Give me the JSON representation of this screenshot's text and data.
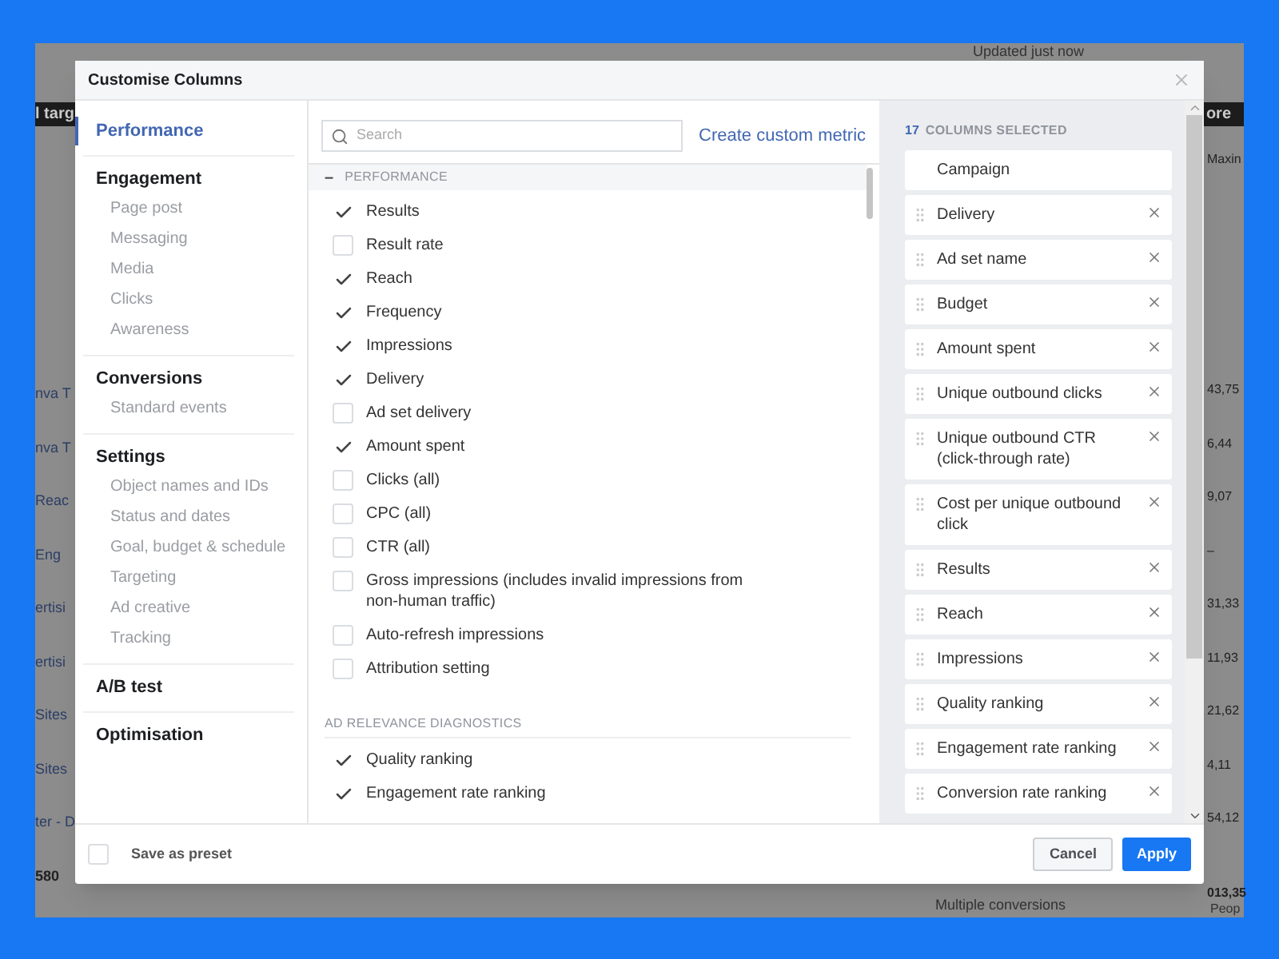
{
  "background_page": {
    "status": "Updated just now",
    "band_left": "l targ",
    "band_right": "ore",
    "column_header": "Maxin",
    "left_cells": [
      "nva T",
      "nva T",
      "Reac",
      "Eng",
      "ertisi",
      "ertisi",
      "Sites",
      "Sites",
      "ter - D",
      "580"
    ],
    "right_cells": [
      "43,75",
      "6,44",
      "9,07",
      "–",
      "31,33",
      "11,93",
      "21,62",
      "4,11",
      "54,12"
    ],
    "footer_cells": [
      "013,35",
      "Multiple conversions",
      "Peop"
    ]
  },
  "dialog": {
    "title": "Customise Columns"
  },
  "nav": [
    {
      "label": "Performance",
      "selected": true
    },
    {
      "label": "Engagement",
      "selected": false,
      "children": [
        "Page post",
        "Messaging",
        "Media",
        "Clicks",
        "Awareness"
      ]
    },
    {
      "label": "Conversions",
      "selected": false,
      "children": [
        "Standard events"
      ]
    },
    {
      "label": "Settings",
      "selected": false,
      "children": [
        "Object names and IDs",
        "Status and dates",
        "Goal, budget & schedule",
        "Targeting",
        "Ad creative",
        "Tracking"
      ]
    },
    {
      "label": "A/B test",
      "selected": false
    },
    {
      "label": "Optimisation",
      "selected": false
    }
  ],
  "search": {
    "placeholder": "Search"
  },
  "create_link": "Create custom metric",
  "metric_groups": [
    {
      "title": "PERFORMANCE",
      "kind": "collapsible",
      "expanded": true,
      "toggle": "–",
      "items": [
        {
          "label": "Results",
          "checked": true
        },
        {
          "label": "Result rate",
          "checked": false
        },
        {
          "label": "Reach",
          "checked": true
        },
        {
          "label": "Frequency",
          "checked": true
        },
        {
          "label": "Impressions",
          "checked": true
        },
        {
          "label": "Delivery",
          "checked": true
        },
        {
          "label": "Ad set delivery",
          "checked": false
        },
        {
          "label": "Amount spent",
          "checked": true
        },
        {
          "label": "Clicks (all)",
          "checked": false
        },
        {
          "label": "CPC (all)",
          "checked": false
        },
        {
          "label": "CTR (all)",
          "checked": false
        },
        {
          "label": "Gross impressions (includes invalid impressions from non-human traffic)",
          "checked": false
        },
        {
          "label": "Auto-refresh impressions",
          "checked": false
        },
        {
          "label": "Attribution setting",
          "checked": false
        }
      ]
    },
    {
      "title": "AD RELEVANCE DIAGNOSTICS",
      "kind": "subheading",
      "items": [
        {
          "label": "Quality ranking",
          "checked": true
        },
        {
          "label": "Engagement rate ranking",
          "checked": true
        }
      ]
    }
  ],
  "selected_columns": {
    "count": "17",
    "label": "COLUMNS SELECTED",
    "items": [
      {
        "label": "Campaign",
        "removable": false
      },
      {
        "label": "Delivery",
        "removable": true
      },
      {
        "label": "Ad set name",
        "removable": true
      },
      {
        "label": "Budget",
        "removable": true
      },
      {
        "label": "Amount spent",
        "removable": true
      },
      {
        "label": "Unique outbound clicks",
        "removable": true
      },
      {
        "label": "Unique outbound CTR (click-through rate)",
        "removable": true
      },
      {
        "label": "Cost per unique outbound click",
        "removable": true
      },
      {
        "label": "Results",
        "removable": true
      },
      {
        "label": "Reach",
        "removable": true
      },
      {
        "label": "Impressions",
        "removable": true
      },
      {
        "label": "Quality ranking",
        "removable": true
      },
      {
        "label": "Engagement rate ranking",
        "removable": true
      },
      {
        "label": "Conversion rate ranking",
        "removable": true
      }
    ]
  },
  "footer": {
    "save_preset": {
      "label": "Save as preset",
      "checked": false
    },
    "buttons": [
      {
        "label": "Cancel",
        "kind": "secondary"
      },
      {
        "label": "Apply",
        "kind": "primary"
      }
    ]
  }
}
